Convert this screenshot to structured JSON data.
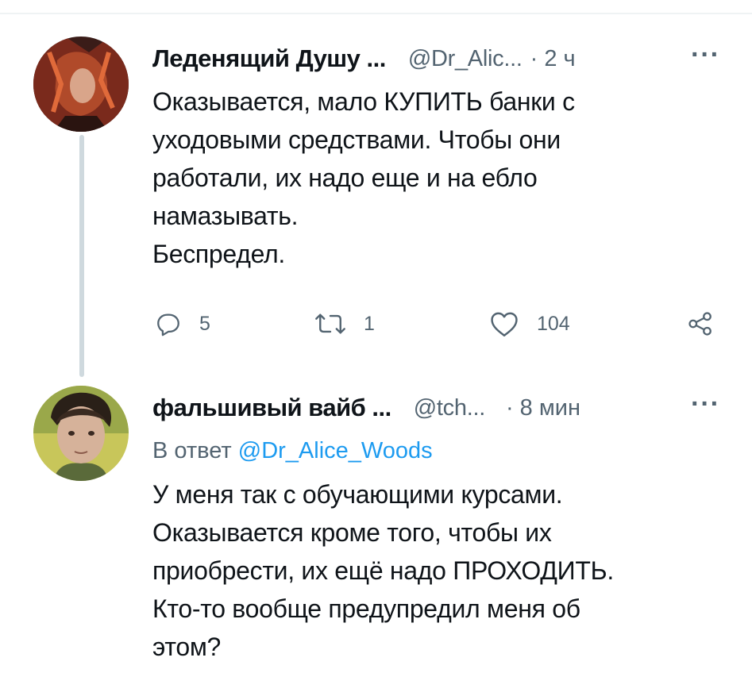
{
  "tweet1": {
    "name": "Леденящий Душу ...",
    "handle": "@Dr_Alic...",
    "time": "· 2 ч",
    "more": "···",
    "text": "Оказывается, мало КУПИТЬ банки с\nуходовыми средствами. Чтобы они\nработали, их надо еще и на ебло\nнамазывать.\nБеспредел.",
    "actions": {
      "replies": "5",
      "retweets": "1",
      "likes": "104"
    },
    "icons": [
      "reply-icon",
      "retweet-icon",
      "like-icon",
      "share-icon"
    ]
  },
  "tweet2": {
    "name": "фальшивый вайб ...",
    "handle": "@tch...",
    "time": "· 8 мин",
    "more": "···",
    "reply_prefix": "В ответ ",
    "reply_handle": "@Dr_Alice_Woods",
    "text": "У меня так с обучающими курсами.\nОказывается кроме того, чтобы их\nприобрести, их ещё надо ПРОХОДИТЬ.\nКто-то вообще предупредил меня об\nэтом?"
  },
  "colors": {
    "text": "#0f1419",
    "secondary": "#536471",
    "link": "#1d9bf0",
    "thread_line": "#cfd9de"
  }
}
